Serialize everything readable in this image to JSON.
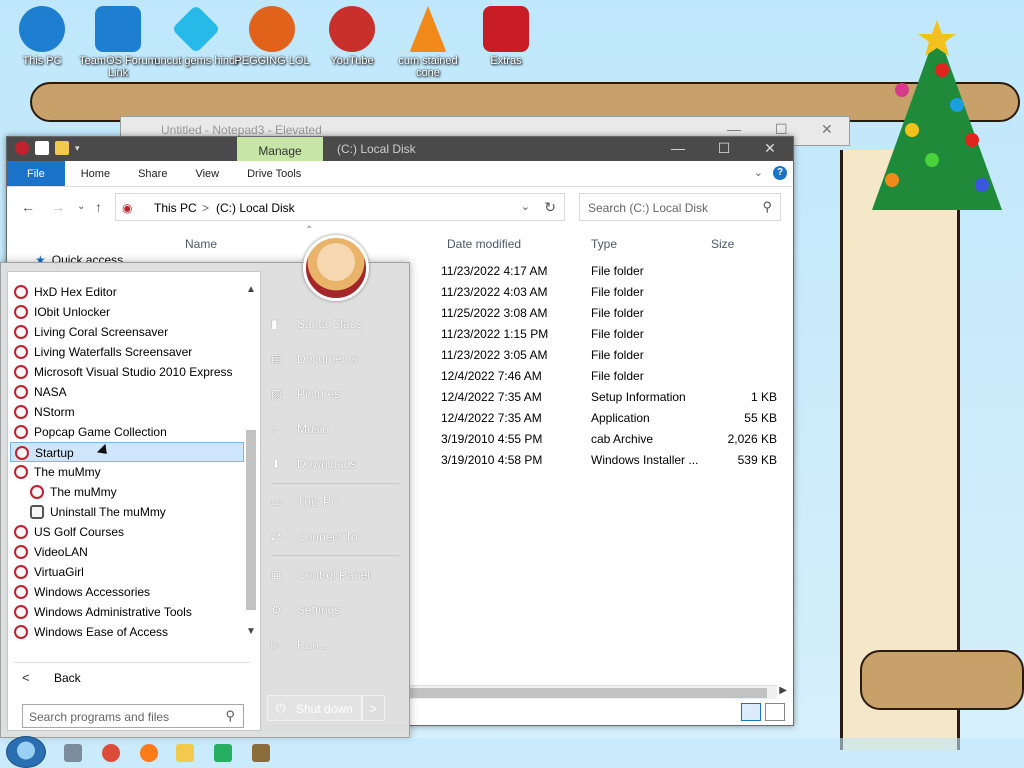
{
  "desktop": {
    "icons": [
      {
        "label": "This PC",
        "color": "#1e7fd1"
      },
      {
        "label": "TeamOS Forum Link",
        "color": "#1e7fd1"
      },
      {
        "label": "uncut gems hindi",
        "color": "#27b9e8"
      },
      {
        "label": "PEGGING LOL",
        "color": "#e0621b"
      },
      {
        "label": "YouTube",
        "color": "#c9302c"
      },
      {
        "label": "cum stained cone",
        "color": "#f28a1a"
      },
      {
        "label": "Extras",
        "color": "#c81d25"
      }
    ]
  },
  "notepad": {
    "title": "Untitled - Notepad3 - Elevated"
  },
  "explorer": {
    "title": "(C:) Local Disk",
    "manage_tab": "Manage",
    "tabs": [
      "File",
      "Home",
      "Share",
      "View",
      "Drive Tools"
    ],
    "address": {
      "root": "This PC",
      "separator": ">",
      "current": "(C:) Local Disk"
    },
    "search_placeholder": "Search (C:) Local Disk",
    "nav": {
      "quick_access": "Quick access"
    },
    "columns": {
      "name": "Name",
      "date": "Date modified",
      "type": "Type",
      "size": "Size"
    },
    "rows": [
      {
        "date": "11/23/2022 4:17 AM",
        "type": "File folder",
        "size": ""
      },
      {
        "date": "11/23/2022 4:03 AM",
        "type": "File folder",
        "size": ""
      },
      {
        "date": "11/25/2022 3:08 AM",
        "type": "File folder",
        "size": ""
      },
      {
        "date": "11/23/2022 1:15 PM",
        "type": "File folder",
        "size": ""
      },
      {
        "date": "11/23/2022 3:05 AM",
        "type": "File folder",
        "size": ""
      },
      {
        "date": "12/4/2022 7:46 AM",
        "type": "File folder",
        "size": ""
      },
      {
        "date": "12/4/2022 7:35 AM",
        "type": "Setup Information",
        "size": "1 KB"
      },
      {
        "date": "12/4/2022 7:35 AM",
        "type": "Application",
        "size": "55 KB"
      },
      {
        "date": "3/19/2010 4:55 PM",
        "type": "cab Archive",
        "size": "2,026 KB"
      },
      {
        "date": "3/19/2010 4:58 PM",
        "type": "Windows Installer ...",
        "size": "539 KB"
      }
    ]
  },
  "startmenu": {
    "programs": [
      {
        "label": "HxD Hex Editor",
        "sub": false,
        "selected": false
      },
      {
        "label": "IObit Unlocker",
        "sub": false,
        "selected": false
      },
      {
        "label": "Living Coral Screensaver",
        "sub": false,
        "selected": false
      },
      {
        "label": "Living Waterfalls Screensaver",
        "sub": false,
        "selected": false
      },
      {
        "label": "Microsoft Visual Studio 2010 Express",
        "sub": false,
        "selected": false
      },
      {
        "label": "NASA",
        "sub": false,
        "selected": false
      },
      {
        "label": "NStorm",
        "sub": false,
        "selected": false
      },
      {
        "label": "Popcap Game Collection",
        "sub": false,
        "selected": false
      },
      {
        "label": "Startup",
        "sub": false,
        "selected": true
      },
      {
        "label": "The muMmy",
        "sub": false,
        "selected": false
      },
      {
        "label": "The muMmy",
        "sub": true,
        "selected": false
      },
      {
        "label": "Uninstall The muMmy",
        "sub": true,
        "selected": false
      },
      {
        "label": "US Golf Courses",
        "sub": false,
        "selected": false
      },
      {
        "label": "VideoLAN",
        "sub": false,
        "selected": false
      },
      {
        "label": "VirtuaGirl",
        "sub": false,
        "selected": false
      },
      {
        "label": "Windows Accessories",
        "sub": false,
        "selected": false
      },
      {
        "label": "Windows Administrative Tools",
        "sub": false,
        "selected": false
      },
      {
        "label": "Windows Ease of Access",
        "sub": false,
        "selected": false
      }
    ],
    "back_label": "Back",
    "search_placeholder": "Search programs and files",
    "right_links": [
      {
        "label": "Santa Claus",
        "icon": "user-icon"
      },
      {
        "label": "Documents",
        "icon": "documents-icon"
      },
      {
        "label": "Pictures",
        "icon": "pictures-icon"
      },
      {
        "label": "Music",
        "icon": "music-icon"
      },
      {
        "label": "Downloads",
        "icon": "downloads-icon"
      },
      {
        "label": "This PC",
        "icon": "computer-icon"
      },
      {
        "label": "Connect To",
        "icon": "connect-icon"
      },
      {
        "label": "Control Panel",
        "icon": "control-panel-icon"
      },
      {
        "label": "Settings",
        "icon": "settings-icon"
      },
      {
        "label": "Run...",
        "icon": "run-icon"
      }
    ],
    "shutdown_label": "Shut down"
  },
  "colors": {
    "accent": "#1a73c9",
    "manage_tab": "#c6e5a6",
    "selection": "#cfe5fb",
    "titlebar": "#4a4a4a"
  }
}
